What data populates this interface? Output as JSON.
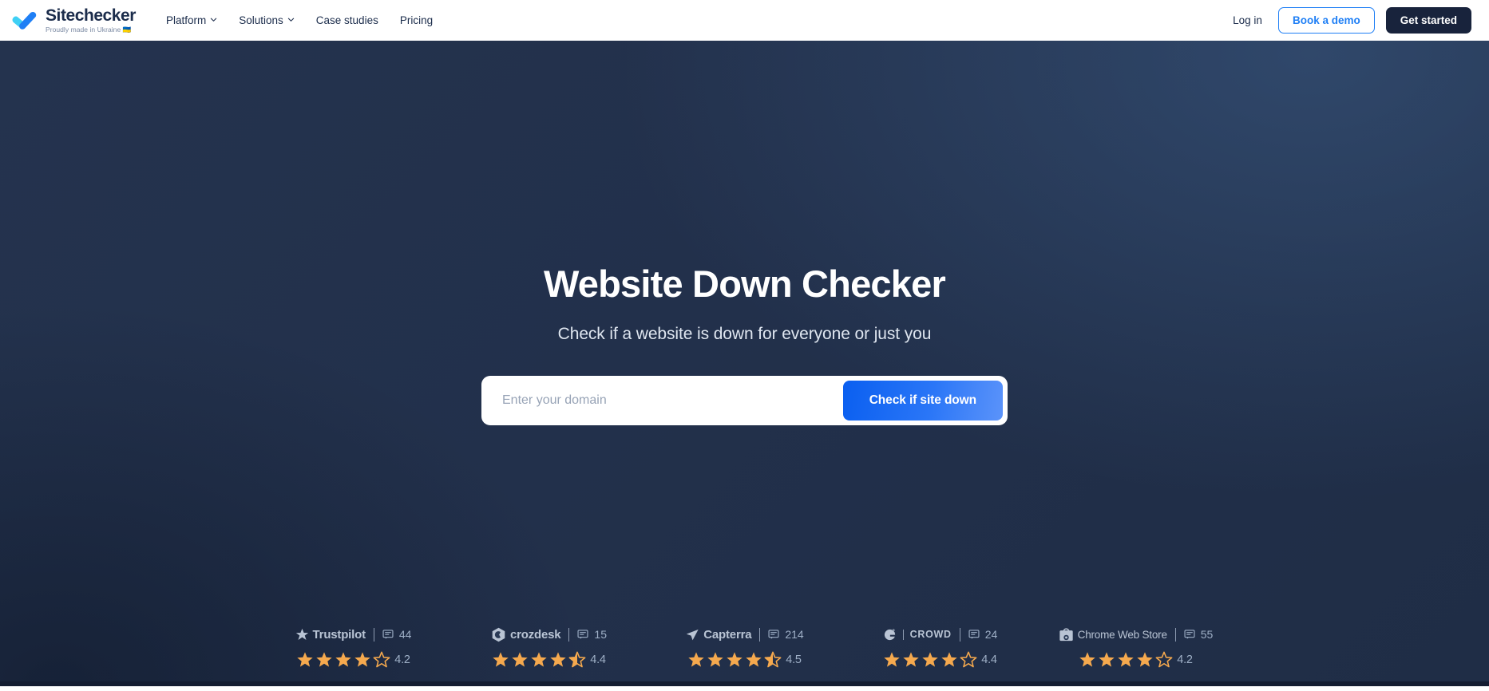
{
  "brand": {
    "name": "Sitechecker",
    "tagline": "Proudly made in Ukraine 🇺🇦",
    "logo_icon": "checkmark-logo-icon",
    "color_light": "#3fd0f5",
    "color_dark": "#1f7ff5"
  },
  "nav": {
    "items": [
      {
        "label": "Platform",
        "has_dropdown": true,
        "icon": "chevron-down-icon"
      },
      {
        "label": "Solutions",
        "has_dropdown": true,
        "icon": "chevron-down-icon"
      },
      {
        "label": "Case studies",
        "has_dropdown": false
      },
      {
        "label": "Pricing",
        "has_dropdown": false
      }
    ],
    "login_label": "Log in",
    "demo_label": "Book a demo",
    "get_started_label": "Get started"
  },
  "hero": {
    "title": "Website Down Checker",
    "subtitle": "Check if a website is down for everyone or just you",
    "background_color": "#22304b",
    "search": {
      "placeholder": "Enter your domain",
      "value": "",
      "button_label": "Check if site down",
      "button_color": "#1f7ff5"
    }
  },
  "badges": [
    {
      "name": "Trustpilot",
      "logo_icon": "trustpilot-star-icon",
      "reviews_icon": "comment-icon",
      "reviews": "44",
      "rating": "4.2",
      "full_stars": 4,
      "half_stars": 0,
      "empty_stars": 1,
      "star_color": "#f5a94e"
    },
    {
      "name": "crozdesk",
      "logo_icon": "crozdesk-hex-icon",
      "reviews_icon": "comment-icon",
      "reviews": "15",
      "rating": "4.4",
      "full_stars": 4,
      "half_stars": 1,
      "empty_stars": 0,
      "star_color": "#f5a94e"
    },
    {
      "name": "Capterra",
      "logo_icon": "capterra-arrow-icon",
      "reviews_icon": "comment-icon",
      "reviews": "214",
      "rating": "4.5",
      "full_stars": 4,
      "half_stars": 1,
      "empty_stars": 0,
      "star_color": "#f5a94e"
    },
    {
      "name": "CROWD",
      "logo_icon": "g2-crowd-icon",
      "reviews_icon": "comment-icon",
      "reviews": "24",
      "rating": "4.4",
      "full_stars": 4,
      "half_stars": 0,
      "empty_stars": 1,
      "star_color": "#f5a94e"
    },
    {
      "name": "Chrome Web Store",
      "logo_icon": "chrome-web-store-icon",
      "reviews_icon": "comment-icon",
      "reviews": "55",
      "rating": "4.2",
      "full_stars": 4,
      "half_stars": 0,
      "empty_stars": 1,
      "star_color": "#f5a94e"
    }
  ]
}
